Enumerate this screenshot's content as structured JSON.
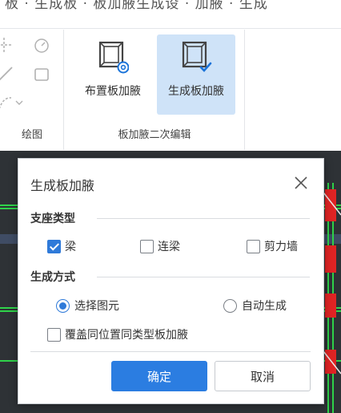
{
  "top_strip": {
    "text": "板 · 生成板 · 板加腋生成设 · 加腋 · 生成"
  },
  "ribbon": {
    "groups": [
      {
        "label": "绘图"
      },
      {
        "label": "板加腋二次编辑",
        "buttons": [
          {
            "label": "布置板加腋",
            "icon": "frame-gear-icon",
            "active": false
          },
          {
            "label": "生成板加腋",
            "icon": "frame-check-icon",
            "active": true
          }
        ]
      }
    ]
  },
  "dialog": {
    "title": "生成板加腋",
    "support_type": {
      "heading": "支座类型",
      "options": [
        {
          "label": "梁",
          "checked": true
        },
        {
          "label": "连梁",
          "checked": false
        },
        {
          "label": "剪力墙",
          "checked": false
        }
      ]
    },
    "method": {
      "heading": "生成方式",
      "options": [
        {
          "label": "选择图元",
          "selected": true
        },
        {
          "label": "自动生成",
          "selected": false
        }
      ]
    },
    "overwrite": {
      "label": "覆盖同位置同类型板加腋",
      "checked": false
    },
    "ok_label": "确定",
    "cancel_label": "取消"
  },
  "colors": {
    "accent": "#2b7de1",
    "ribbon_active": "#cfe3f8",
    "canvas_bg": "#2e3236",
    "grid_green": "#2fd24a",
    "grid_red": "#e02424"
  }
}
